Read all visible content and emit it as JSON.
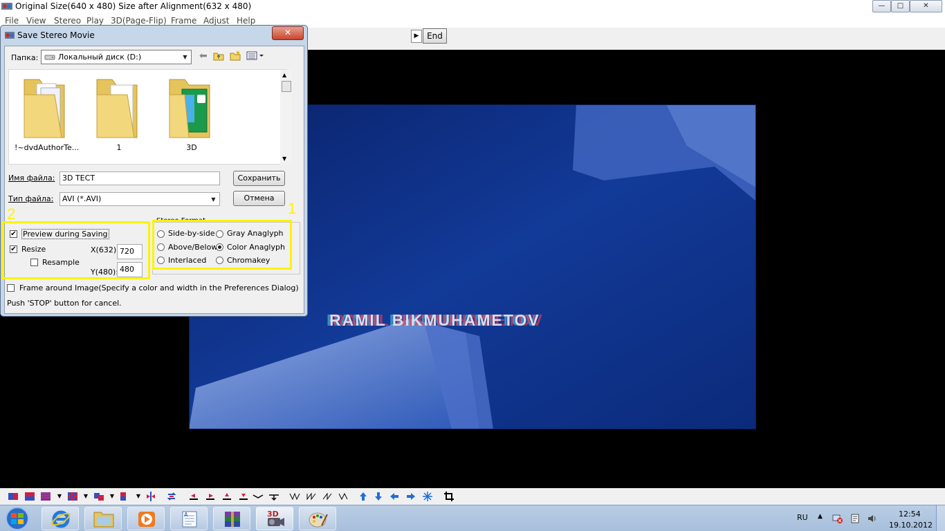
{
  "window": {
    "title": "Original Size(640 x 480)  Size after Alignment(632 x 480)",
    "minimize": "—",
    "maximize": "□",
    "close": "✕"
  },
  "menu": [
    "File",
    "View",
    "Stereo",
    "Play",
    "3D(Page-Flip)",
    "Frame",
    "Adjust",
    "Help"
  ],
  "seekbar": {
    "arrow": "▶",
    "end_label": "End"
  },
  "video": {
    "caption": "RAMIL BIKMUHAMETOV"
  },
  "dialog": {
    "title": "Save Stereo Movie",
    "close": "✕",
    "look_in_label": "Папка:",
    "look_in_value": "Локальный диск (D:)",
    "folders": [
      {
        "name": "!~dvdAuthorTe..."
      },
      {
        "name": "1"
      },
      {
        "name": "3D"
      }
    ],
    "filename_label": "Имя файла:",
    "filename_value": "3D ТЕСТ",
    "filetype_label": "Тип файла:",
    "filetype_value": "AVI (*.AVI)",
    "save_button": "Сохранить",
    "cancel_button": "Отмена",
    "preview_label": "Preview during Saving",
    "preview_checked": true,
    "resize_label": "Resize",
    "resize_checked": true,
    "resample_label": "Resample",
    "resample_checked": false,
    "x_label": "X(632):",
    "x_value": "720",
    "y_label": "Y(480):",
    "y_value": "480",
    "stereo_format_label": "Stereo Format",
    "formats_left": [
      {
        "label": "Side-by-side",
        "selected": false
      },
      {
        "label": "Above/Below",
        "selected": false
      },
      {
        "label": "Interlaced",
        "selected": false
      }
    ],
    "formats_right": [
      {
        "label": "Gray Anaglyph",
        "selected": false
      },
      {
        "label": "Color Anaglyph",
        "selected": true
      },
      {
        "label": "Chromakey",
        "selected": false
      }
    ],
    "frame_label": "Frame around Image(Specify a color and width in the Preferences Dialog)",
    "frame_checked": false,
    "status": "Push 'STOP' button for cancel."
  },
  "annotations": {
    "marker_1": "1",
    "marker_2": "2"
  },
  "colors": {
    "highlight": "#fff200",
    "video_bg": "#0c2a78"
  },
  "tray": {
    "lang": "RU",
    "time": "12:54",
    "date": "19.10.2012"
  }
}
